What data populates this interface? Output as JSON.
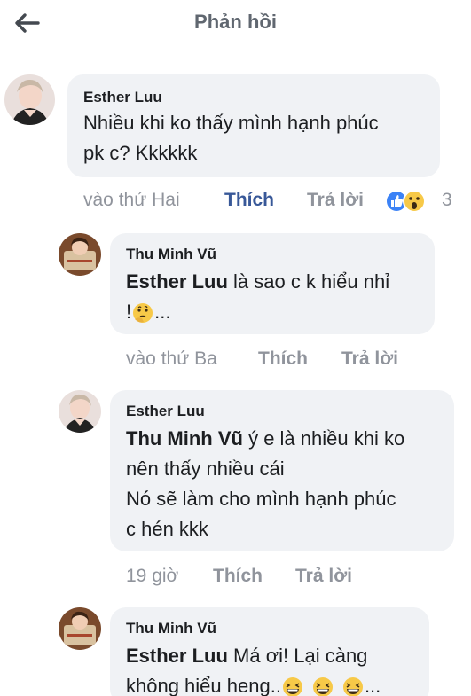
{
  "header": {
    "title": "Phản hồi"
  },
  "comments": [
    {
      "author": "Esther Luu",
      "lines": [
        "Nhiều khi ko thấy mình hạnh phúc",
        "pk c? Kkkkkk"
      ],
      "time": "vào thứ Hai",
      "like_label": "Thích",
      "reply_label": "Trả lời",
      "reaction_count": "3",
      "reactions": [
        "like-icon",
        "wow-icon"
      ]
    },
    {
      "author": "Thu Minh Vũ",
      "mention": "Esther Luu",
      "line1_rest": " là sao c k hiểu nhỉ",
      "line2_start": "!",
      "line2_end": "...",
      "emoji": "thinking-face-icon",
      "time": "vào thứ Ba",
      "like_label": "Thích",
      "reply_label": "Trả lời"
    },
    {
      "author": "Esther Luu",
      "mention": "Thu Minh Vũ",
      "line1_rest": " ý e là nhiều khi ko",
      "line2": "nên thấy nhiều cái",
      "line3": "Nó sẽ làm cho mình hạnh phúc",
      "line4": "c hén kkk",
      "time": "19 giờ",
      "like_label": "Thích",
      "reply_label": "Trả lời"
    },
    {
      "author": "Thu Minh Vũ",
      "mention": "Esther Luu",
      "line1_rest": " Má ơi! Lại càng",
      "line2_start": "không hiểu heng..",
      "line2_end": "...",
      "emoji": "grinning-squinting-face-icon"
    }
  ],
  "colors": {
    "like_active": "#385898",
    "meta": "#90949c",
    "bubble": "#f0f2f5"
  }
}
